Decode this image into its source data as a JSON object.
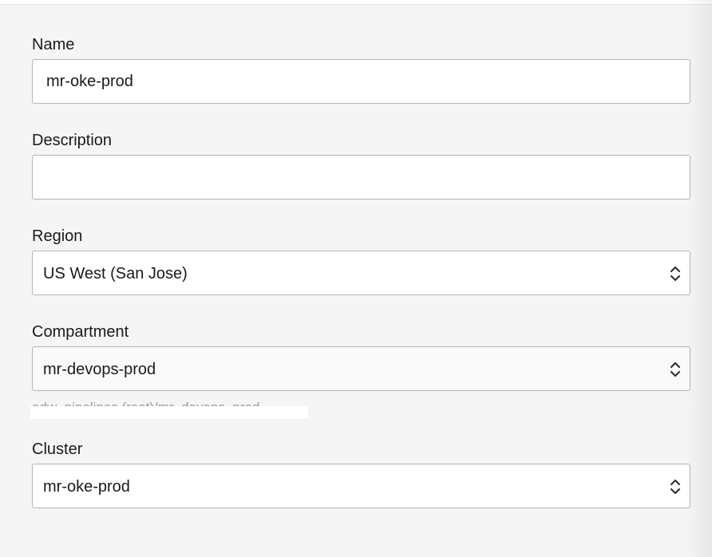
{
  "form": {
    "name": {
      "label": "Name",
      "value": "mr-oke-prod"
    },
    "description": {
      "label": "Description",
      "value": ""
    },
    "region": {
      "label": "Region",
      "selected": "US West (San Jose)"
    },
    "compartment": {
      "label": "Compartment",
      "selected": "mr-devops-prod",
      "hint": "adw_pipelines (root)/mr_devops_prod"
    },
    "cluster": {
      "label": "Cluster",
      "selected": "mr-oke-prod"
    }
  },
  "icons": {
    "select_indicator": "chevron-up-down-icon"
  },
  "colors": {
    "background": "#f5f5f5",
    "input_border": "#b5b5b5",
    "text": "#1a1a1a"
  }
}
